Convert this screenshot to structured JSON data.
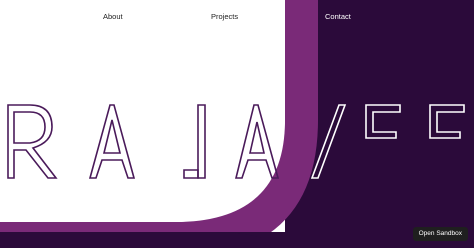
{
  "nav": {
    "about_label": "About",
    "projects_label": "Projects",
    "contact_label": "Contact"
  },
  "hero": {
    "lettering": "RAJAVEE",
    "icon": "outlined-display-lettering"
  },
  "sandbox": {
    "button_label": "Open Sandbox"
  },
  "colors": {
    "background_light": "#ffffff",
    "accent_magenta": "#7a2a78",
    "deep_purple": "#2b0a3a",
    "lettering_stroke_light": "#4a1a5a",
    "lettering_stroke_dark": "#ffffff",
    "sandbox_button_bg": "#1f1f1f"
  }
}
